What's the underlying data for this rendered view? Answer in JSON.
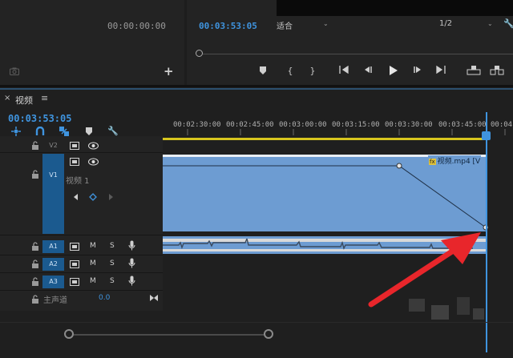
{
  "source_monitor": {
    "timecode": "00:00:00:00"
  },
  "program_monitor": {
    "timecode": "00:03:53:05",
    "fit_label": "适合",
    "resolution": "1/2"
  },
  "timeline": {
    "tab_label": "视频",
    "close_glyph": "×",
    "menu_glyph": "≡",
    "timecode": "00:03:53:05",
    "ruler_ticks": [
      "00:02:30:00",
      "00:02:45:00",
      "00:03:00:00",
      "00:03:15:00",
      "00:03:30:00",
      "00:03:45:00",
      "00:04"
    ],
    "tracks": {
      "v2": {
        "label": "V2"
      },
      "v1": {
        "label": "V1",
        "name": "视频 1"
      },
      "a1": {
        "label": "A1",
        "m": "M",
        "s": "S"
      },
      "a2": {
        "label": "A2",
        "m": "M",
        "s": "S"
      },
      "a3": {
        "label": "A3",
        "m": "M",
        "s": "S"
      },
      "master": {
        "label": "主声道",
        "value": "0.0"
      }
    },
    "clip": {
      "fx": "fx",
      "label": "视频.mp4 [V"
    }
  },
  "colors": {
    "accent": "#3f94df",
    "clip": "#6d9cd2",
    "target": "#1b5a8f",
    "annotation_arrow": "#e8262b"
  }
}
